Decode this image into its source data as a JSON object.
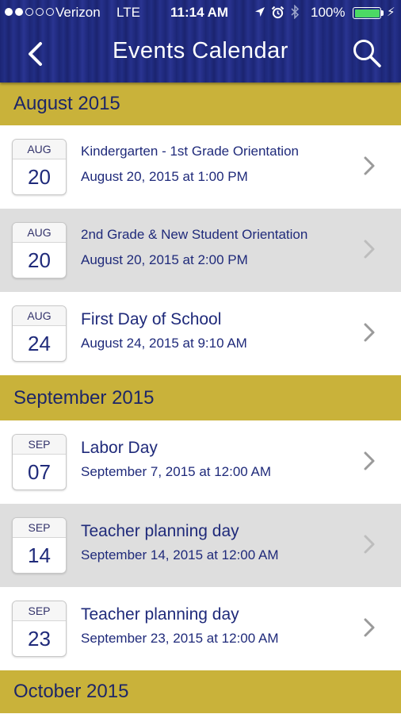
{
  "status_bar": {
    "carrier": "Verizon",
    "network": "LTE",
    "time": "11:14 AM",
    "battery": "100%",
    "signal_bars_filled": 2,
    "signal_bars_total": 5
  },
  "nav": {
    "title": "Events Calendar",
    "back_icon": "chevron-left-icon",
    "search_icon": "search-icon"
  },
  "colors": {
    "nav_bar": "#1f2a7a",
    "month_header": "#c9b23a",
    "text_primary": "#1f2a7a",
    "row_alt": "#dedede",
    "battery_fill": "#4cd964"
  },
  "months": [
    {
      "label": "August 2015",
      "events": [
        {
          "month": "AUG",
          "day": "20",
          "title": "Kindergarten - 1st Grade Orientation",
          "date": "August 20, 2015 at 1:00 PM"
        },
        {
          "month": "AUG",
          "day": "20",
          "title": "2nd Grade & New Student Orientation",
          "date": "August 20, 2015 at 2:00 PM"
        },
        {
          "month": "AUG",
          "day": "24",
          "title": "First Day of School",
          "date": "August 24, 2015 at 9:10 AM"
        }
      ]
    },
    {
      "label": "September 2015",
      "events": [
        {
          "month": "SEP",
          "day": "07",
          "title": "Labor Day",
          "date": "September 7, 2015 at 12:00 AM"
        },
        {
          "month": "SEP",
          "day": "14",
          "title": "Teacher planning day",
          "date": "September 14, 2015 at 12:00 AM"
        },
        {
          "month": "SEP",
          "day": "23",
          "title": "Teacher planning day",
          "date": "September 23, 2015 at 12:00 AM"
        }
      ]
    },
    {
      "label": "October 2015",
      "events": []
    }
  ]
}
